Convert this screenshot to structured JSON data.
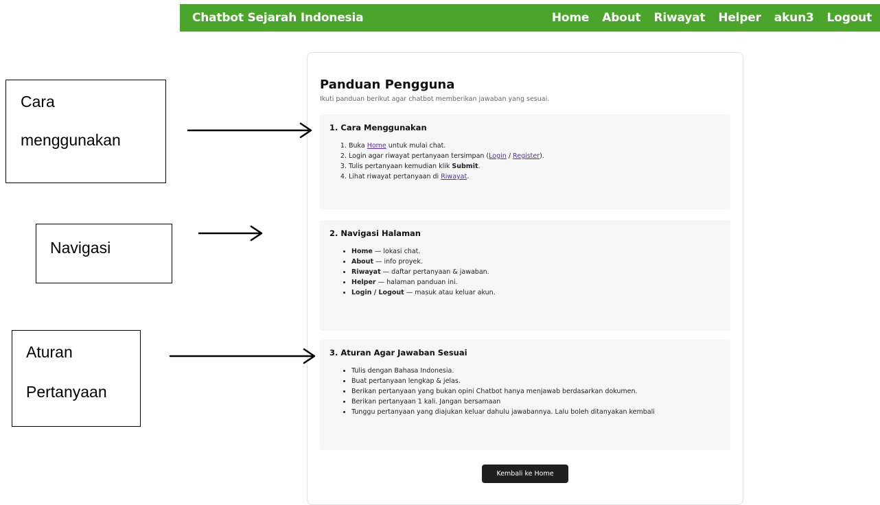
{
  "navbar": {
    "brand": "Chatbot Sejarah Indonesia",
    "links": [
      "Home",
      "About",
      "Riwayat",
      "Helper",
      "akun3",
      "Logout"
    ]
  },
  "page": {
    "title": "Panduan Pengguna",
    "subtitle": "Ikuti panduan berikut agar chatbot memberikan jawaban yang sesuai."
  },
  "sections": [
    {
      "title": "1. Cara Menggunakan",
      "items": [
        {
          "pre": "Buka ",
          "link": "Home",
          "post": " untuk mulai chat."
        },
        {
          "pre": "Login agar riwayat pertanyaan tersimpan (",
          "link1": "Login",
          "mid": " / ",
          "link2": "Register",
          "post": ")."
        },
        {
          "pre": "Tulis pertanyaan kemudian klik ",
          "bold": "Submit",
          "post": "."
        },
        {
          "pre": "Lihat riwayat pertanyaan di ",
          "link": "Riwayat",
          "post": "."
        }
      ]
    },
    {
      "title": "2. Navigasi Halaman",
      "items": [
        {
          "bold": "Home",
          "text": " — lokasi chat."
        },
        {
          "bold": "About",
          "text": " — info proyek."
        },
        {
          "bold": "Riwayat",
          "text": " — daftar pertanyaan & jawaban."
        },
        {
          "bold": "Helper",
          "text": " — halaman panduan ini."
        },
        {
          "bold": "Login / Logout",
          "text": " — masuk atau keluar akun."
        }
      ]
    },
    {
      "title": "3. Aturan Agar Jawaban Sesuai",
      "items": [
        "Tulis dengan Bahasa Indonesia.",
        "Buat pertanyaan lengkap & jelas.",
        "Berikan pertanyaan yang bukan opini Chatbot hanya menjawab berdasarkan dokumen.",
        "Berikan pertanyaan 1 kali. Jangan bersamaan",
        "Tunggu pertanyaan yang diajukan keluar dahulu jawabannya. Lalu boleh ditanyakan kembali"
      ]
    }
  ],
  "back_button": "Kembali ke Home",
  "annotations": {
    "box1": [
      "Cara",
      "menggunakan"
    ],
    "box2": "Navigasi",
    "box3": [
      "Aturan",
      "Pertanyaan"
    ]
  },
  "colors": {
    "navbar": "#4aa52a",
    "link": "#5a2ca0",
    "button": "#1f1f1f",
    "section_bg": "#f6f6f6"
  }
}
